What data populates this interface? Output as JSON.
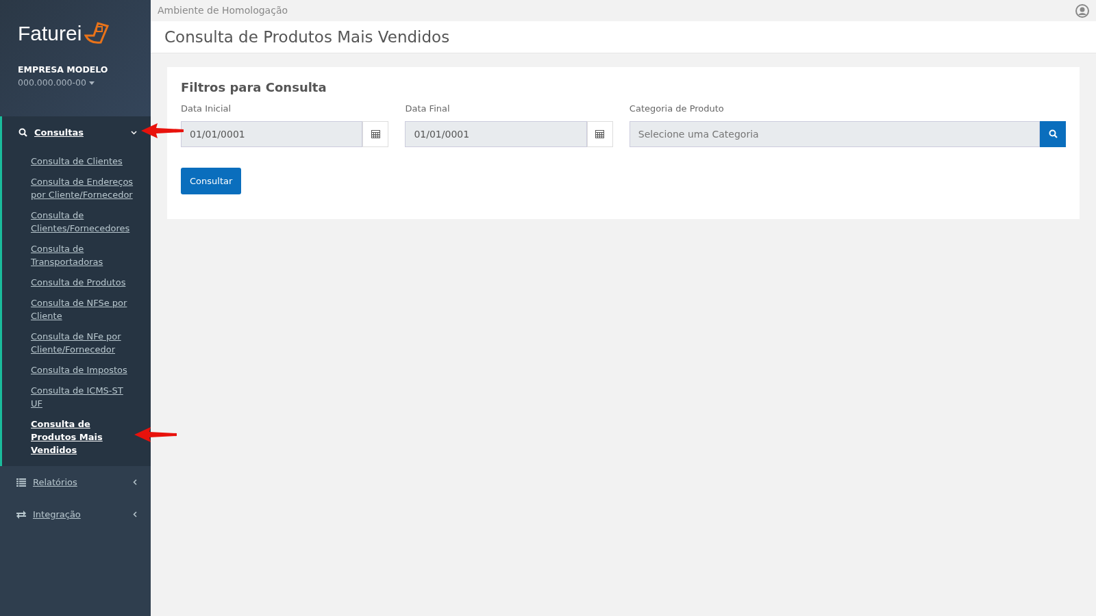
{
  "sidebar": {
    "logo": "Faturei",
    "company": "EMPRESA MODELO",
    "company_id": "000.000.000-00",
    "menu": [
      {
        "kind": "search",
        "label": "Consultas",
        "expanded": true,
        "children": [
          {
            "label": "Consulta de Clientes",
            "selected": false
          },
          {
            "label": "Consulta de Endereços por Cliente/Fornecedor",
            "selected": false
          },
          {
            "label": "Consulta de Clientes/Fornecedores",
            "selected": false
          },
          {
            "label": "Consulta de Transportadoras",
            "selected": false
          },
          {
            "label": "Consulta de Produtos",
            "selected": false
          },
          {
            "label": "Consulta de NFSe por Cliente",
            "selected": false
          },
          {
            "label": "Consulta de NFe por Cliente/Fornecedor",
            "selected": false
          },
          {
            "label": "Consulta de Impostos",
            "selected": false
          },
          {
            "label": "Consulta de ICMS-ST UF",
            "selected": false
          },
          {
            "label": "Consulta de Produtos Mais Vendidos",
            "selected": true
          }
        ]
      },
      {
        "kind": "list",
        "label": "Relatórios",
        "expanded": false
      },
      {
        "kind": "exchange",
        "label": "Integração",
        "expanded": false
      }
    ]
  },
  "topbar": {
    "environment": "Ambiente de Homologação"
  },
  "page_title": "Consulta de Produtos Mais Vendidos",
  "filters": {
    "title": "Filtros para Consulta",
    "fields": [
      {
        "kind": "date",
        "label": "Data Inicial",
        "value": "01/01/0001"
      },
      {
        "kind": "date",
        "label": "Data Final",
        "value": "01/01/0001"
      },
      {
        "kind": "search",
        "label": "Categoria de Produto",
        "placeholder": "Selecione uma Categoria"
      }
    ],
    "button": "Consultar"
  }
}
